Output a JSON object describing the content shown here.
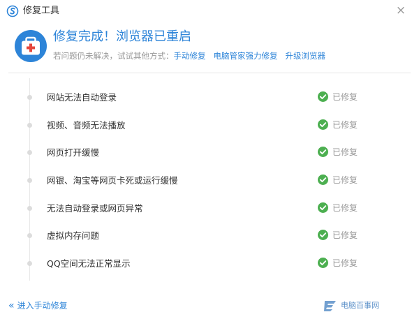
{
  "window": {
    "title": "修复工具",
    "close_glyph": "×"
  },
  "header": {
    "headline": "修复完成！浏览器已重启",
    "prompt": "若问题仍未解决，试试其他方式：",
    "links": [
      "手动修复",
      "电脑管家强力修复",
      "升级浏览器"
    ]
  },
  "items": [
    {
      "label": "网站无法自动登录",
      "status": "已修复"
    },
    {
      "label": "视频、音频无法播放",
      "status": "已修复"
    },
    {
      "label": "网页打开缓慢",
      "status": "已修复"
    },
    {
      "label": "网银、淘宝等网页卡死或运行缓慢",
      "status": "已修复"
    },
    {
      "label": "无法自动登录或网页异常",
      "status": "已修复"
    },
    {
      "label": "虚拟内存问题",
      "status": "已修复"
    },
    {
      "label": "QQ空间无法正常显示",
      "status": "已修复"
    }
  ],
  "footer": {
    "manual_link_chevron": "«",
    "manual_link": "进入手动修复",
    "brand_text": "电脑百事网"
  },
  "colors": {
    "accent": "#2d84d8",
    "success": "#4caf50",
    "kit_red": "#e5453b"
  },
  "icons": {
    "app_logo": "browser-logo-icon",
    "kit": "first-aid-kit-icon",
    "check": "check-circle-icon",
    "brand": "brand-logo-icon"
  }
}
